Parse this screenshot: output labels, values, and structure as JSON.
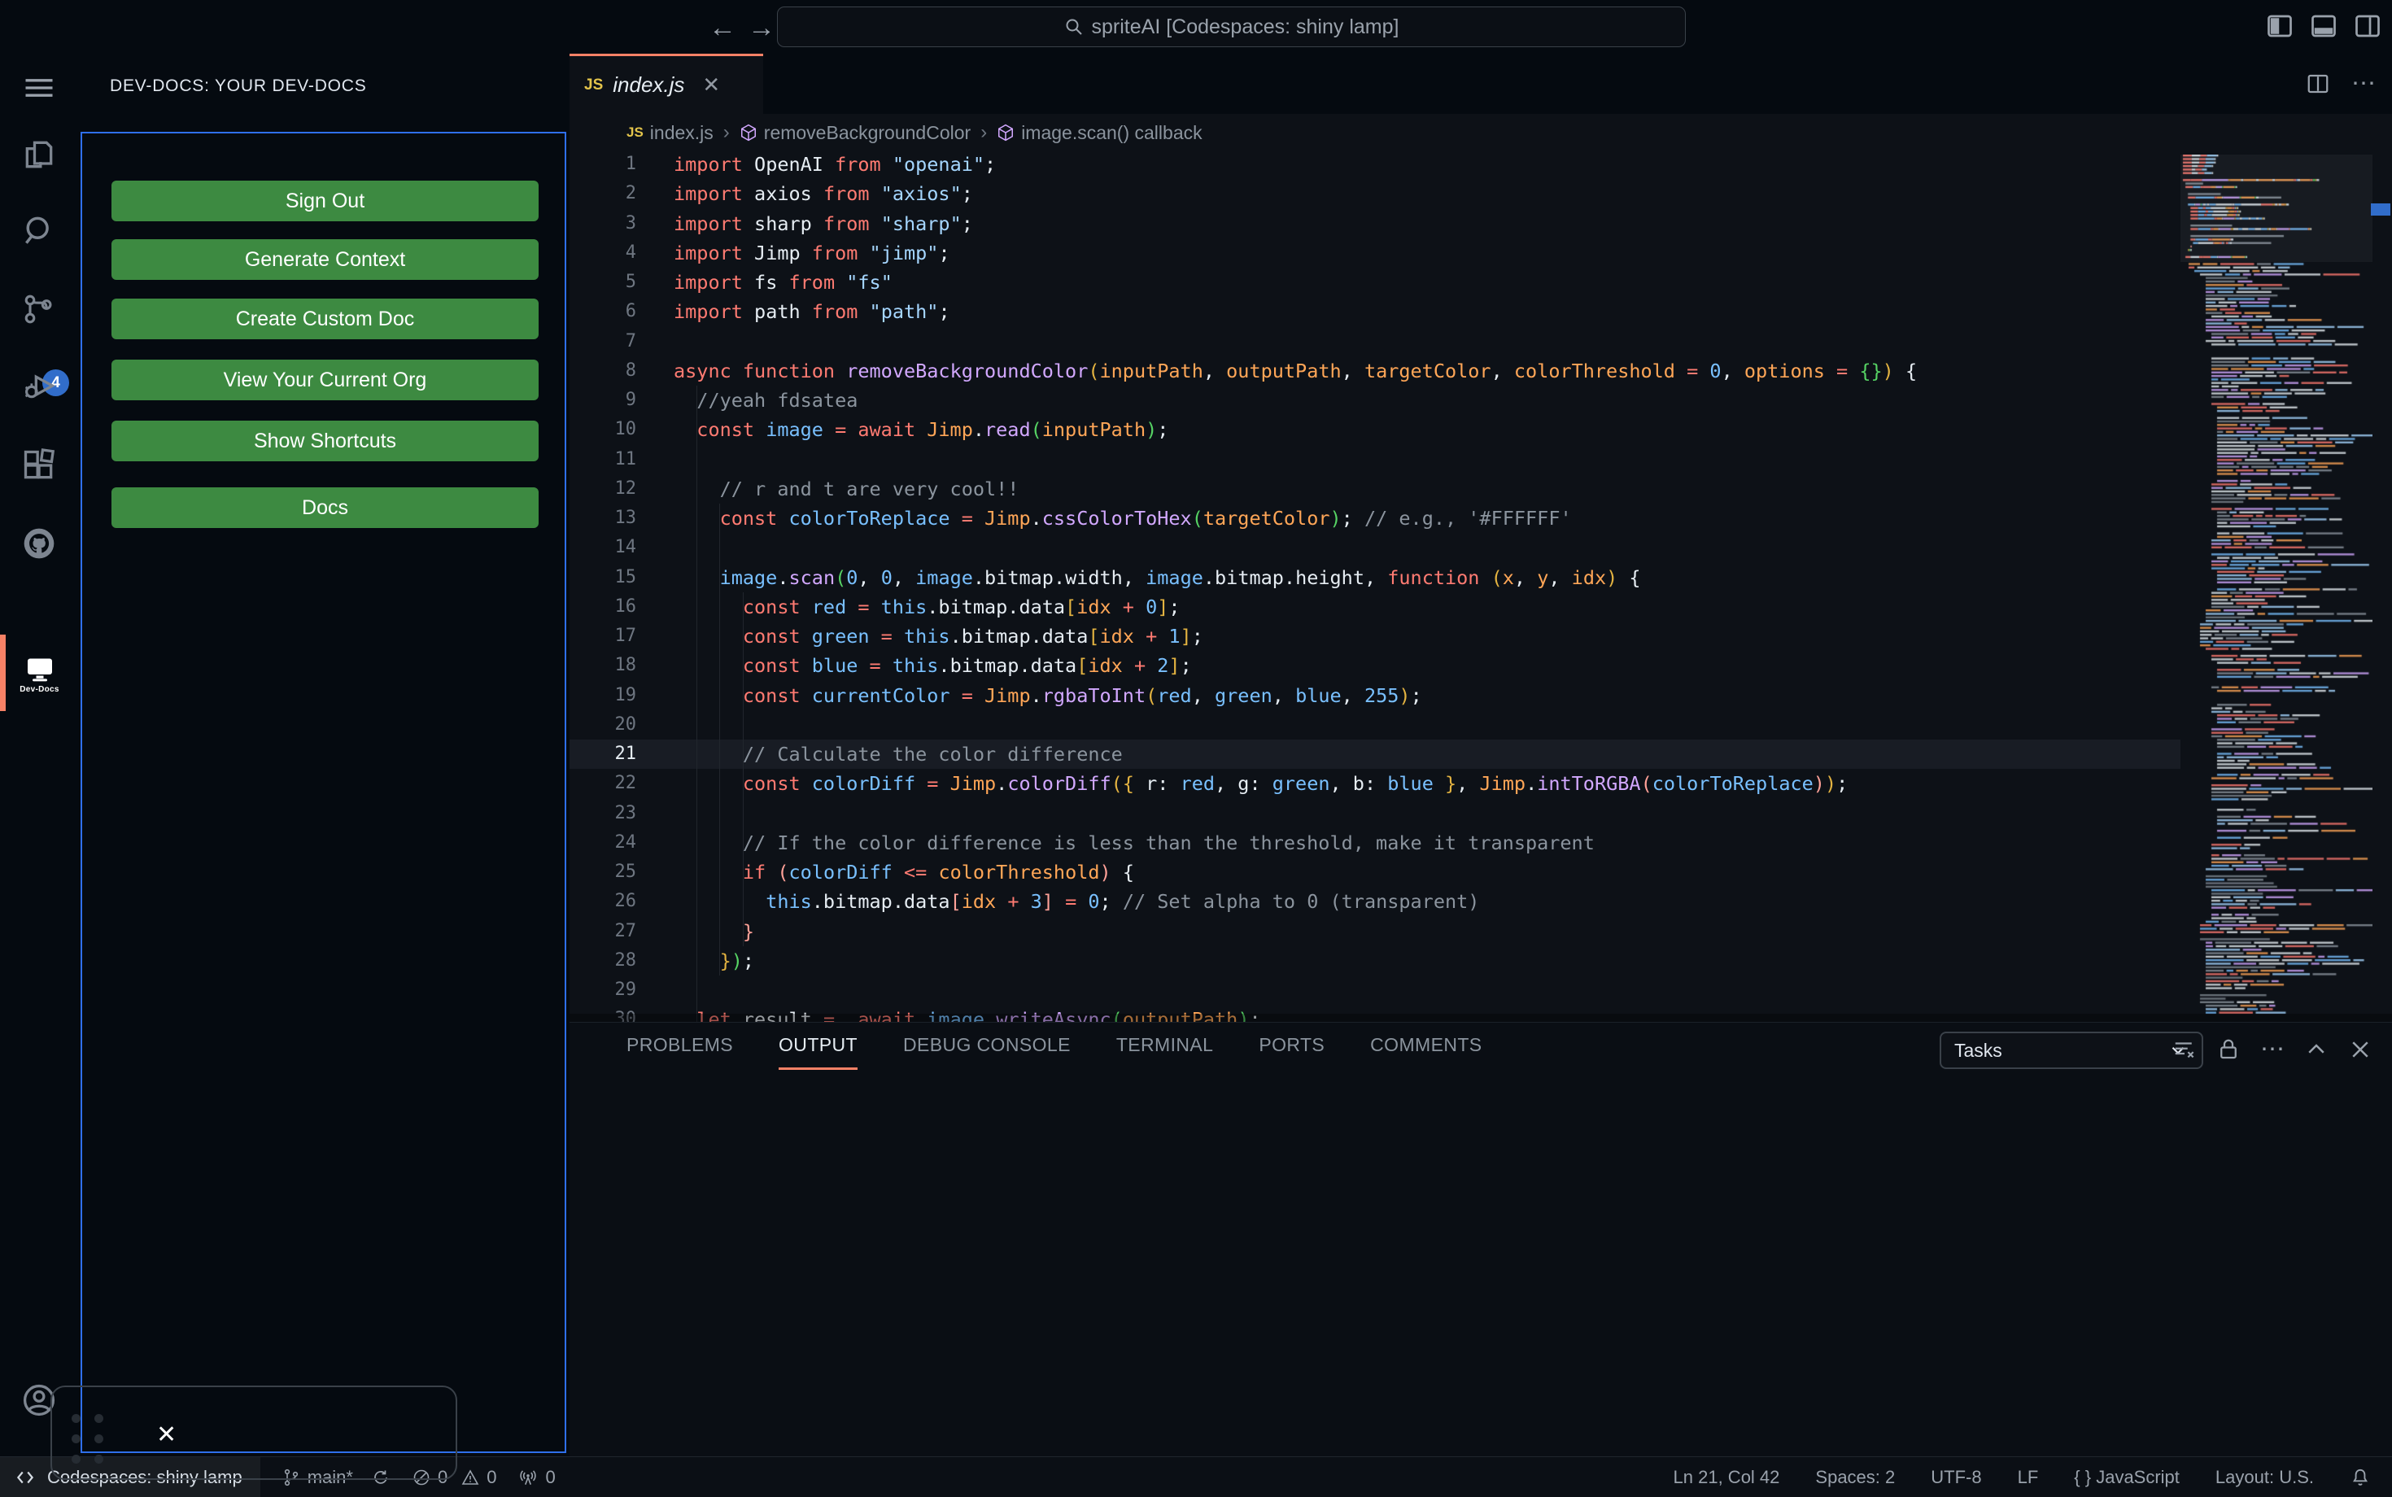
{
  "title_bar": {
    "search_value": "spriteAI [Codespaces: shiny lamp]",
    "back_icon": "←",
    "forward_icon": "→"
  },
  "activity_bar": {
    "source_control_badge": "4",
    "dev_docs_label": "Dev-Docs",
    "active_item": "dev-docs"
  },
  "sidebar": {
    "title": "DEV-DOCS: YOUR DEV-DOCS",
    "button_color": "#3d8a41",
    "buttons": [
      "Sign Out",
      "Generate Context",
      "Create Custom Doc",
      "View Your Current Org",
      "Show Shortcuts",
      "Docs"
    ]
  },
  "editor": {
    "tab": {
      "label": "index.js",
      "icon": "JS",
      "close": "✕"
    },
    "breadcrumbs": [
      {
        "icon": "js",
        "label": "index.js"
      },
      {
        "icon": "symbol",
        "label": "removeBackgroundColor"
      },
      {
        "icon": "symbol",
        "label": "image.scan() callback"
      }
    ],
    "active_line": 21,
    "token_colors": {
      "k": "#ff7b72",
      "f": "#d2a8ff",
      "v": "#79c0ff",
      "p": "#ffa657",
      "s": "#a5d6ff",
      "c": "#8b949e",
      "t": "#e6edf3",
      "b1": "#e3b341",
      "b2": "#56d364",
      "b3": "#ffa198"
    },
    "lines": [
      [
        [
          "k",
          "import "
        ],
        [
          "t",
          "OpenAI "
        ],
        [
          "k",
          "from "
        ],
        [
          "s",
          "\"openai\""
        ],
        [
          "t",
          ";"
        ]
      ],
      [
        [
          "k",
          "import "
        ],
        [
          "t",
          "axios "
        ],
        [
          "k",
          "from "
        ],
        [
          "s",
          "\"axios\""
        ],
        [
          "t",
          ";"
        ]
      ],
      [
        [
          "k",
          "import "
        ],
        [
          "t",
          "sharp "
        ],
        [
          "k",
          "from "
        ],
        [
          "s",
          "\"sharp\""
        ],
        [
          "t",
          ";"
        ]
      ],
      [
        [
          "k",
          "import "
        ],
        [
          "t",
          "Jimp "
        ],
        [
          "k",
          "from "
        ],
        [
          "s",
          "\"jimp\""
        ],
        [
          "t",
          ";"
        ]
      ],
      [
        [
          "k",
          "import "
        ],
        [
          "t",
          "fs "
        ],
        [
          "k",
          "from "
        ],
        [
          "s",
          "\"fs\""
        ]
      ],
      [
        [
          "k",
          "import "
        ],
        [
          "t",
          "path "
        ],
        [
          "k",
          "from "
        ],
        [
          "s",
          "\"path\""
        ],
        [
          "t",
          ";"
        ]
      ],
      [],
      [
        [
          "k",
          "async "
        ],
        [
          "k",
          "function "
        ],
        [
          "f",
          "removeBackgroundColor"
        ],
        [
          "b1",
          "("
        ],
        [
          "p",
          "inputPath"
        ],
        [
          "t",
          ", "
        ],
        [
          "p",
          "outputPath"
        ],
        [
          "t",
          ", "
        ],
        [
          "p",
          "targetColor"
        ],
        [
          "t",
          ", "
        ],
        [
          "p",
          "colorThreshold "
        ],
        [
          "k",
          "= "
        ],
        [
          "v",
          "0"
        ],
        [
          "t",
          ", "
        ],
        [
          "p",
          "options "
        ],
        [
          "k",
          "= "
        ],
        [
          "b2",
          "{}"
        ],
        [
          "b1",
          ")"
        ],
        [
          "t",
          " {"
        ]
      ],
      [
        [
          "t",
          "  "
        ],
        [
          "c",
          "//yeah fdsatea"
        ]
      ],
      [
        [
          "t",
          "  "
        ],
        [
          "k",
          "const "
        ],
        [
          "v",
          "image "
        ],
        [
          "k",
          "= "
        ],
        [
          "k",
          "await "
        ],
        [
          "p",
          "Jimp"
        ],
        [
          "t",
          "."
        ],
        [
          "f",
          "read"
        ],
        [
          "b2",
          "("
        ],
        [
          "p",
          "inputPath"
        ],
        [
          "b2",
          ")"
        ],
        [
          "t",
          ";"
        ]
      ],
      [],
      [
        [
          "t",
          "    "
        ],
        [
          "c",
          "// r and t are very cool!!"
        ]
      ],
      [
        [
          "t",
          "    "
        ],
        [
          "k",
          "const "
        ],
        [
          "v",
          "colorToReplace "
        ],
        [
          "k",
          "= "
        ],
        [
          "p",
          "Jimp"
        ],
        [
          "t",
          "."
        ],
        [
          "f",
          "cssColorToHex"
        ],
        [
          "b2",
          "("
        ],
        [
          "p",
          "targetColor"
        ],
        [
          "b2",
          ")"
        ],
        [
          "t",
          "; "
        ],
        [
          "c",
          "// e.g., '#FFFFFF'"
        ]
      ],
      [],
      [
        [
          "t",
          "    "
        ],
        [
          "v",
          "image"
        ],
        [
          "t",
          "."
        ],
        [
          "f",
          "scan"
        ],
        [
          "b2",
          "("
        ],
        [
          "v",
          "0"
        ],
        [
          "t",
          ", "
        ],
        [
          "v",
          "0"
        ],
        [
          "t",
          ", "
        ],
        [
          "v",
          "image"
        ],
        [
          "t",
          ".bitmap.width"
        ],
        [
          "t",
          ", "
        ],
        [
          "v",
          "image"
        ],
        [
          "t",
          ".bitmap.height"
        ],
        [
          "t",
          ", "
        ],
        [
          "k",
          "function "
        ],
        [
          "b1",
          "("
        ],
        [
          "p",
          "x"
        ],
        [
          "t",
          ", "
        ],
        [
          "p",
          "y"
        ],
        [
          "t",
          ", "
        ],
        [
          "p",
          "idx"
        ],
        [
          "b1",
          ")"
        ],
        [
          "t",
          " {"
        ]
      ],
      [
        [
          "t",
          "      "
        ],
        [
          "k",
          "const "
        ],
        [
          "v",
          "red "
        ],
        [
          "k",
          "= "
        ],
        [
          "v",
          "this"
        ],
        [
          "t",
          ".bitmap.data"
        ],
        [
          "b1",
          "["
        ],
        [
          "p",
          "idx "
        ],
        [
          "k",
          "+ "
        ],
        [
          "v",
          "0"
        ],
        [
          "b1",
          "]"
        ],
        [
          "t",
          ";"
        ]
      ],
      [
        [
          "t",
          "      "
        ],
        [
          "k",
          "const "
        ],
        [
          "v",
          "green "
        ],
        [
          "k",
          "= "
        ],
        [
          "v",
          "this"
        ],
        [
          "t",
          ".bitmap.data"
        ],
        [
          "b1",
          "["
        ],
        [
          "p",
          "idx "
        ],
        [
          "k",
          "+ "
        ],
        [
          "v",
          "1"
        ],
        [
          "b1",
          "]"
        ],
        [
          "t",
          ";"
        ]
      ],
      [
        [
          "t",
          "      "
        ],
        [
          "k",
          "const "
        ],
        [
          "v",
          "blue "
        ],
        [
          "k",
          "= "
        ],
        [
          "v",
          "this"
        ],
        [
          "t",
          ".bitmap.data"
        ],
        [
          "b1",
          "["
        ],
        [
          "p",
          "idx "
        ],
        [
          "k",
          "+ "
        ],
        [
          "v",
          "2"
        ],
        [
          "b1",
          "]"
        ],
        [
          "t",
          ";"
        ]
      ],
      [
        [
          "t",
          "      "
        ],
        [
          "k",
          "const "
        ],
        [
          "v",
          "currentColor "
        ],
        [
          "k",
          "= "
        ],
        [
          "p",
          "Jimp"
        ],
        [
          "t",
          "."
        ],
        [
          "f",
          "rgbaToInt"
        ],
        [
          "b1",
          "("
        ],
        [
          "v",
          "red"
        ],
        [
          "t",
          ", "
        ],
        [
          "v",
          "green"
        ],
        [
          "t",
          ", "
        ],
        [
          "v",
          "blue"
        ],
        [
          "t",
          ", "
        ],
        [
          "v",
          "255"
        ],
        [
          "b1",
          ")"
        ],
        [
          "t",
          ";"
        ]
      ],
      [],
      [
        [
          "t",
          "      "
        ],
        [
          "c",
          "// Calculate the color difference"
        ]
      ],
      [
        [
          "t",
          "      "
        ],
        [
          "k",
          "const "
        ],
        [
          "v",
          "colorDiff "
        ],
        [
          "k",
          "= "
        ],
        [
          "p",
          "Jimp"
        ],
        [
          "t",
          "."
        ],
        [
          "f",
          "colorDiff"
        ],
        [
          "b1",
          "("
        ],
        [
          "b1",
          "{"
        ],
        [
          "t",
          " r: "
        ],
        [
          "v",
          "red"
        ],
        [
          "t",
          ", g: "
        ],
        [
          "v",
          "green"
        ],
        [
          "t",
          ", b: "
        ],
        [
          "v",
          "blue "
        ],
        [
          "b1",
          "}"
        ],
        [
          "t",
          ", "
        ],
        [
          "p",
          "Jimp"
        ],
        [
          "t",
          "."
        ],
        [
          "f",
          "intToRGBA"
        ],
        [
          "b3",
          "("
        ],
        [
          "v",
          "colorToReplace"
        ],
        [
          "b3",
          ")"
        ],
        [
          "b1",
          ")"
        ],
        [
          "t",
          ";"
        ]
      ],
      [],
      [
        [
          "t",
          "      "
        ],
        [
          "c",
          "// If the color difference is less than the threshold, make it transparent"
        ]
      ],
      [
        [
          "t",
          "      "
        ],
        [
          "k",
          "if "
        ],
        [
          "b3",
          "("
        ],
        [
          "v",
          "colorDiff "
        ],
        [
          "k",
          "<= "
        ],
        [
          "p",
          "colorThreshold"
        ],
        [
          "b3",
          ")"
        ],
        [
          "t",
          " {"
        ]
      ],
      [
        [
          "t",
          "        "
        ],
        [
          "v",
          "this"
        ],
        [
          "t",
          ".bitmap.data"
        ],
        [
          "b3",
          "["
        ],
        [
          "p",
          "idx "
        ],
        [
          "k",
          "+ "
        ],
        [
          "v",
          "3"
        ],
        [
          "b3",
          "]"
        ],
        [
          "t",
          " "
        ],
        [
          "k",
          "= "
        ],
        [
          "v",
          "0"
        ],
        [
          "t",
          "; "
        ],
        [
          "c",
          "// Set alpha to 0 (transparent)"
        ]
      ],
      [
        [
          "t",
          "      "
        ],
        [
          "b3",
          "}"
        ]
      ],
      [
        [
          "t",
          "    "
        ],
        [
          "b1",
          "}"
        ],
        [
          "b2",
          ")"
        ],
        [
          "t",
          ";"
        ]
      ],
      [],
      [
        [
          "t",
          "  "
        ],
        [
          "k",
          "let "
        ],
        [
          "t",
          "result "
        ],
        [
          "k",
          "=  "
        ],
        [
          "k",
          "await "
        ],
        [
          "v",
          "image"
        ],
        [
          "t",
          "."
        ],
        [
          "f",
          "writeAsync"
        ],
        [
          "b2",
          "("
        ],
        [
          "p",
          "outputPath"
        ],
        [
          "b2",
          ")"
        ],
        [
          "t",
          ";"
        ]
      ]
    ]
  },
  "panel": {
    "tabs": [
      "PROBLEMS",
      "OUTPUT",
      "DEBUG CONSOLE",
      "TERMINAL",
      "PORTS",
      "COMMENTS"
    ],
    "active_tab": "OUTPUT",
    "dropdown_value": "Tasks",
    "accent": "#f78166"
  },
  "status_bar": {
    "remote_label": "Codespaces: shiny lamp",
    "branch_label": "main*",
    "errors_count": "0",
    "warnings_count": "0",
    "ports_count": "0",
    "line_col": "Ln 21, Col 42",
    "spaces": "Spaces: 2",
    "encoding": "UTF-8",
    "eol": "LF",
    "language": "JavaScript",
    "braces_icon": "{ }",
    "layout": "Layout: U.S."
  },
  "overlay": {
    "close_icon": "✕"
  }
}
